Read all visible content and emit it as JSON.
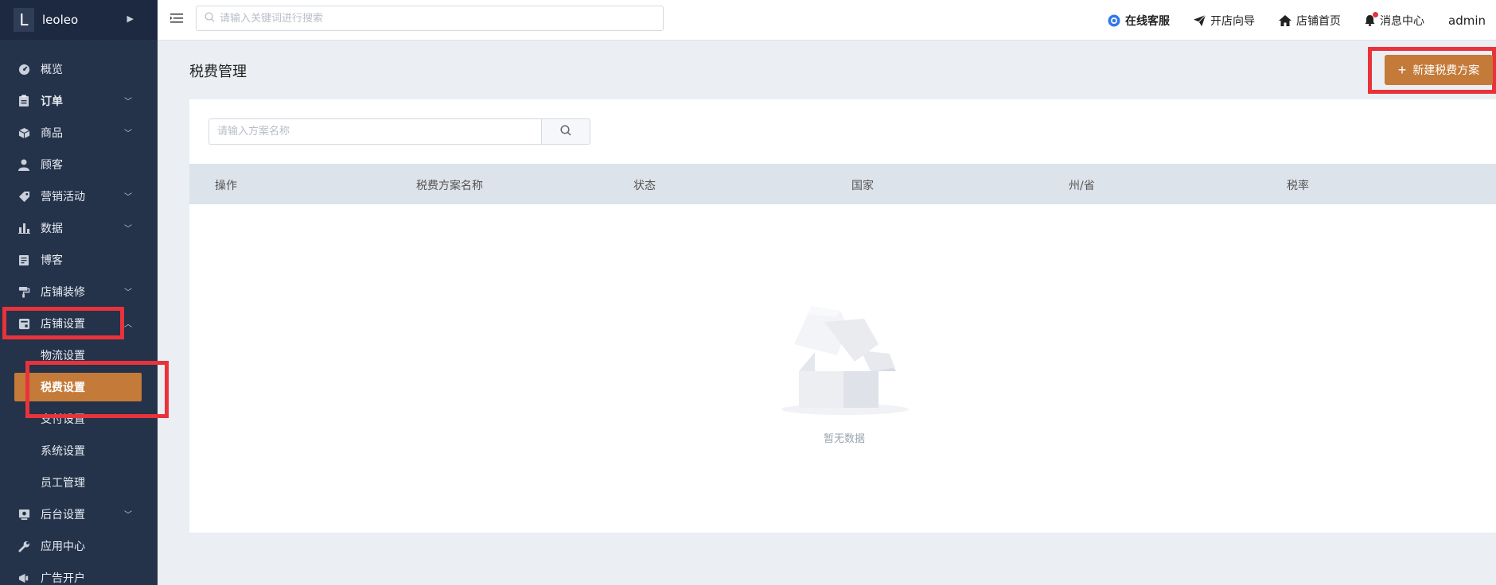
{
  "sidebar": {
    "brand_letter": "L",
    "brand_name": "leoleo",
    "items": [
      {
        "label": "概览",
        "icon": "dashboard-icon",
        "bold": false,
        "expandable": false
      },
      {
        "label": "订单",
        "icon": "order-icon",
        "bold": true,
        "expandable": true
      },
      {
        "label": "商品",
        "icon": "box-icon",
        "bold": false,
        "expandable": true
      },
      {
        "label": "顾客",
        "icon": "user-icon",
        "bold": false,
        "expandable": false
      },
      {
        "label": "营销活动",
        "icon": "tag-icon",
        "bold": false,
        "expandable": true
      },
      {
        "label": "数据",
        "icon": "bar-chart-icon",
        "bold": false,
        "expandable": true
      },
      {
        "label": "博客",
        "icon": "blog-icon",
        "bold": false,
        "expandable": false
      },
      {
        "label": "店铺装修",
        "icon": "paint-roller-icon",
        "bold": false,
        "expandable": true
      },
      {
        "label": "店铺设置",
        "icon": "store-icon",
        "bold": false,
        "expandable": true,
        "expanded": true
      }
    ],
    "submenu": [
      {
        "label": "物流设置",
        "active": false
      },
      {
        "label": "税费设置",
        "active": true
      },
      {
        "label": "支付设置",
        "active": false
      },
      {
        "label": "系统设置",
        "active": false
      },
      {
        "label": "员工管理",
        "active": false
      }
    ],
    "items_after": [
      {
        "label": "后台设置",
        "icon": "monitor-icon",
        "expandable": true
      },
      {
        "label": "应用中心",
        "icon": "wrench-icon",
        "expandable": false
      },
      {
        "label": "广告开户",
        "icon": "megaphone-icon",
        "expandable": false
      }
    ]
  },
  "header": {
    "search_placeholder": "请输入关键词进行搜索",
    "links": [
      {
        "label": "在线客服",
        "icon": "chat-icon"
      },
      {
        "label": "开店向导",
        "icon": "paper-plane-icon"
      },
      {
        "label": "店铺首页",
        "icon": "home-icon"
      },
      {
        "label": "消息中心",
        "icon": "bell-icon"
      }
    ],
    "user": "admin"
  },
  "page": {
    "title": "税费管理",
    "new_button_label": "新建税费方案",
    "filter_placeholder": "请输入方案名称",
    "columns": [
      "操作",
      "税费方案名称",
      "状态",
      "国家",
      "州/省",
      "税率"
    ],
    "empty_text": "暂无数据"
  },
  "colors": {
    "sidebar_bg": "#24324a",
    "accent": "#c47a39",
    "highlight_box": "#e8333b"
  }
}
